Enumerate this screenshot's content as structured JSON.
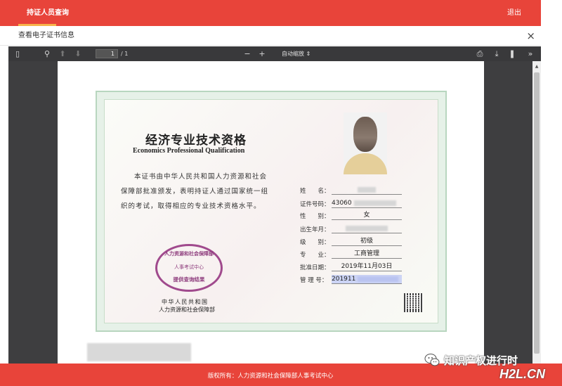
{
  "topbar": {
    "tab_label": "持证人员查询",
    "logout_label": "退出"
  },
  "dialog": {
    "title": "查看电子证书信息",
    "close_glyph": "×"
  },
  "toolbar": {
    "sidebar_glyph": "▯",
    "search_glyph": "⚲",
    "prev_glyph": "⬆",
    "next_glyph": "⬇",
    "page_number": "1",
    "page_total": "/ 1",
    "zoom_out_glyph": "−",
    "zoom_in_glyph": "+",
    "zoom_label": "自动缩放 ⇕",
    "print_glyph": "⎙",
    "download_glyph": "⤓",
    "bookmark_glyph": "❚",
    "more_glyph": "»"
  },
  "certificate": {
    "title_zh": "经济专业技术资格",
    "title_en": "Economics Professional Qualification",
    "body": "本证书由中华人民共和国人力资源和社会保障部批准颁发，表明持证人通过国家统一组织的考试，取得相应的专业技术资格水平。",
    "fields": {
      "name_label": "姓　　名：",
      "id_label": "证件号码：",
      "id_value": "43060",
      "gender_label": "性　　别：",
      "gender_value": "女",
      "birth_label": "出生年月：",
      "level_label": "级　　别：",
      "level_value": "初级",
      "major_label": "专　　业：",
      "major_value": "工商管理",
      "approve_label": "批准日期：",
      "approve_value": "2019年11月03日",
      "manage_label": "管 理 号：",
      "manage_value": "201911"
    },
    "stamp": {
      "line1": "人力资源和社会保障部",
      "line2": "人事考试中心",
      "line3": "提供查询结果"
    },
    "issuer_line1": "中华人民共和国",
    "issuer_line2": "人力资源和社会保障部"
  },
  "footer": {
    "text": "版权所有：人力资源和社会保障部人事考试中心"
  },
  "watermark": {
    "text": "知识产权进行时",
    "site": "H2L.CN"
  },
  "colors": {
    "brand_red": "#e8443a",
    "tab_underline": "#f7b34a",
    "toolbar": "#39393b",
    "stamp": "#a04a8d"
  }
}
